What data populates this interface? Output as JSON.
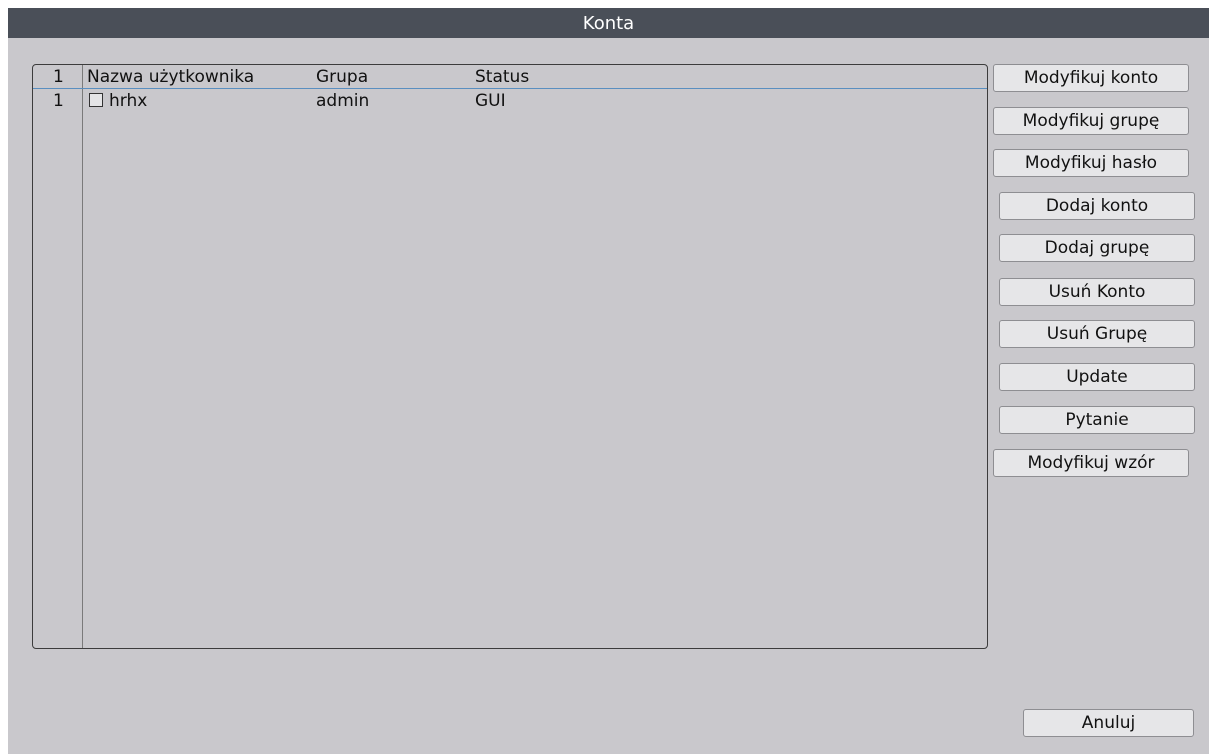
{
  "window": {
    "title": "Konta"
  },
  "table": {
    "header": {
      "index": "1",
      "username": "Nazwa użytkownika",
      "group": "Grupa",
      "status": "Status"
    },
    "rows": [
      {
        "index": "1",
        "checked": false,
        "username": "hrhx",
        "group": "admin",
        "status": "GUI"
      }
    ]
  },
  "actions": {
    "modify_account": "Modyfikuj konto",
    "modify_group": "Modyfikuj grupę",
    "modify_password": "Modyfikuj hasło",
    "add_account": "Dodaj konto",
    "add_group": "Dodaj grupę",
    "delete_account": "Usuń Konto",
    "delete_group": "Usuń Grupę",
    "update": "Update",
    "question": "Pytanie",
    "modify_pattern": "Modyfikuj wzór"
  },
  "footer": {
    "cancel": "Anuluj"
  },
  "colors": {
    "titlebar": "#4a4f58",
    "background": "#c9c8cc",
    "header_line": "#5a8fc0"
  }
}
